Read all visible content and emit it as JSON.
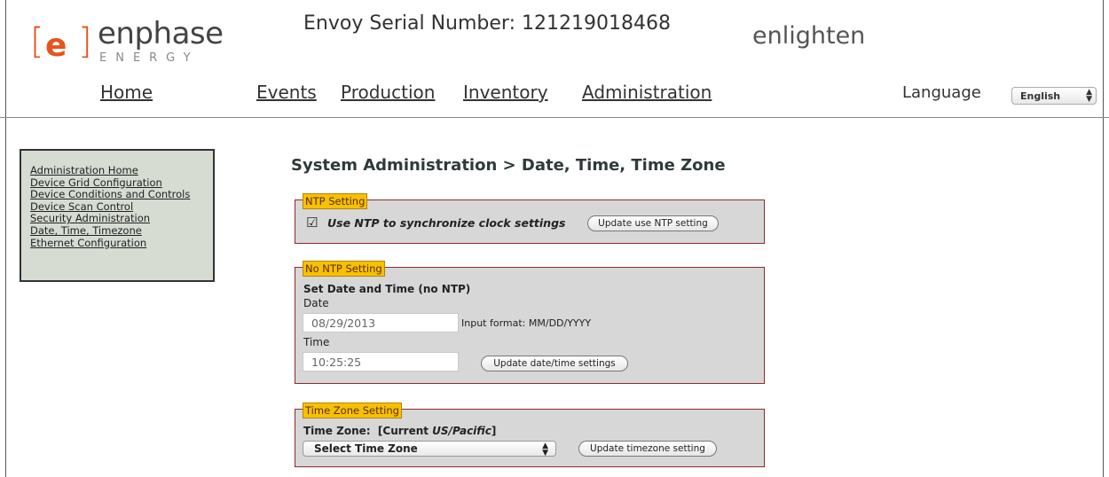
{
  "header": {
    "logo_e": "e",
    "logo_bracket_left": "[",
    "logo_bracket_right": "]",
    "logo_word": "enphase",
    "logo_sub": "ENERGY",
    "serial": "Envoy Serial Number: 121219018468",
    "brand": "enlighten"
  },
  "nav": {
    "home": "Home",
    "events": "Events",
    "production": "Production",
    "inventory": "Inventory",
    "administration": "Administration",
    "language_label": "Language",
    "language_value": "English"
  },
  "sidebar": {
    "items": [
      {
        "label": "Administration Home"
      },
      {
        "label": "Device Grid Configuration"
      },
      {
        "label": "Device Conditions and Controls"
      },
      {
        "label": "Device Scan Control"
      },
      {
        "label": "Security Administration"
      },
      {
        "label": "Date, Time, Timezone"
      },
      {
        "label": "Ethernet Configuration"
      }
    ]
  },
  "main": {
    "title": "System Administration > Date, Time, Time Zone",
    "ntp": {
      "legend": "NTP Setting",
      "checkbox_checked": true,
      "checkbox_glyph": "☑",
      "label": "Use NTP to synchronize clock settings",
      "button": "Update use NTP setting"
    },
    "no_ntp": {
      "legend": "No NTP Setting",
      "heading": "Set Date and Time (no NTP)",
      "date_label": "Date",
      "date_value": "08/29/2013",
      "date_hint": "Input format: MM/DD/YYYY",
      "time_label": "Time",
      "time_value": "10:25:25",
      "button": "Update date/time settings"
    },
    "timezone": {
      "legend": "Time Zone Setting",
      "label_prefix": "Time Zone:  [Current ",
      "label_current": "US/Pacific",
      "label_suffix": "]",
      "select_value": "Select Time Zone",
      "button": "Update timezone setting"
    }
  },
  "colors": {
    "brand_orange": "#e5541d",
    "legend_bg": "#f7c100",
    "panel_bg": "#d7d7d7",
    "sidebar_bg": "#d6dcd2",
    "panel_border": "#8b2b2b"
  }
}
